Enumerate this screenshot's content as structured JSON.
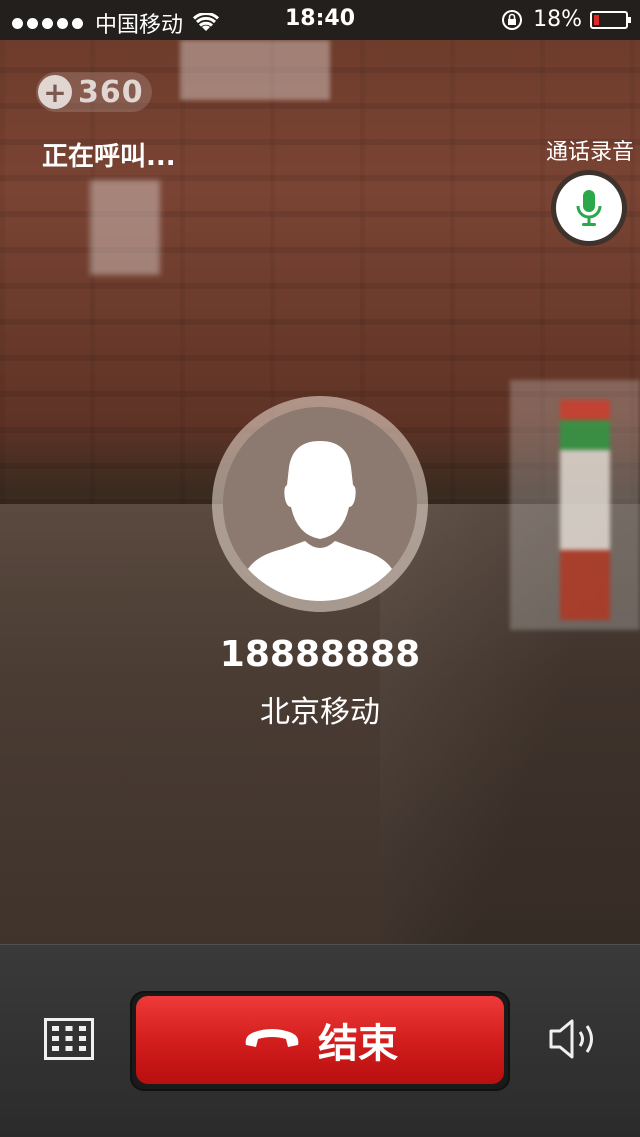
{
  "status_bar": {
    "carrier": "中国移动",
    "time": "18:40",
    "battery_percent": "18%",
    "battery_level": 0.18,
    "icons": [
      "signal-dots",
      "wifi-icon",
      "rotation-lock-icon",
      "battery-icon"
    ]
  },
  "branding": {
    "logo_text": "360",
    "logo_icon": "plus-circle-icon"
  },
  "call": {
    "status_text": "正在呼叫...",
    "record_label": "通话录音",
    "record_icon": "microphone-icon",
    "number": "18888888",
    "location": "北京移动",
    "avatar_icon": "person-avatar-icon"
  },
  "controls": {
    "keypad_icon": "keypad-icon",
    "end_label": "结束",
    "end_icon": "hangup-phone-icon",
    "speaker_icon": "speaker-icon"
  },
  "colors": {
    "end_red": "#d11c1c",
    "mic_green": "#2aa84a",
    "battery_low": "#e02a2a"
  }
}
